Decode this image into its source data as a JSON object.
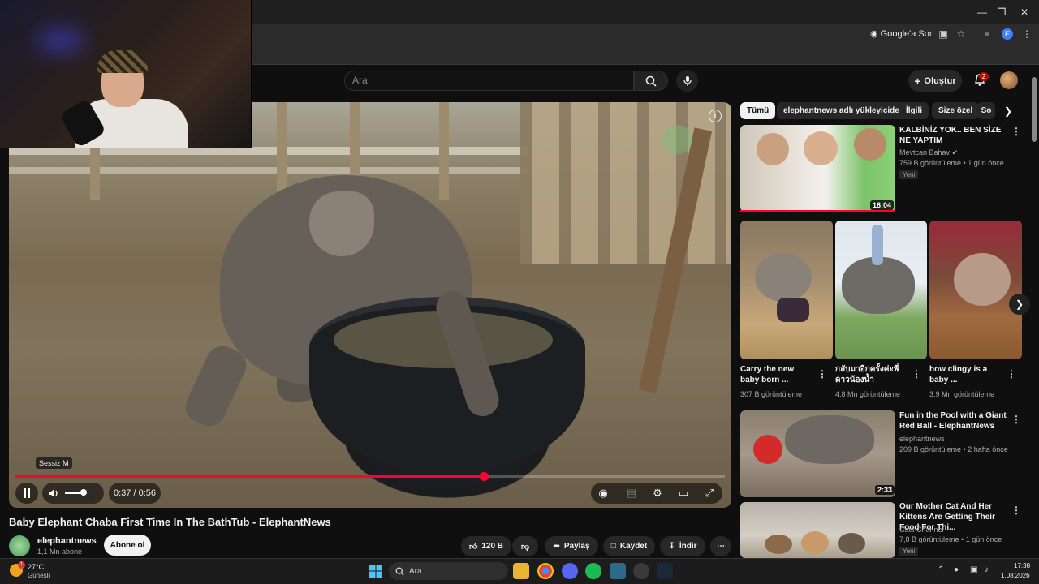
{
  "browser": {
    "google_ask_label": "Google'a Sor",
    "profile_letter": "E"
  },
  "header": {
    "search_placeholder": "Ara",
    "create_label": "Oluştur",
    "notification_count": "2"
  },
  "player": {
    "mute_tooltip": "Sessiz M",
    "time": "0:37 / 0:56",
    "progress_fraction": 0.6607,
    "volume_fraction": 0.6
  },
  "video": {
    "title": "Baby Elephant Chaba First Time In The BathTub - ElephantNews",
    "channel_name": "elephantnews",
    "channel_subs": "1,1 Mn abone",
    "subscribe_label": "Abone ol",
    "likes": "120 B",
    "share_label": "Paylaş",
    "save_label": "Kaydet",
    "download_label": "İndir"
  },
  "sidebar": {
    "chips": [
      "Tümü",
      "elephantnews adlı yükleyiciden",
      "İlgili",
      "Size özel",
      "So"
    ],
    "videos": [
      {
        "title": "KALBİNİZ YOK.. BEN SİZE NE YAPTIM",
        "channel": "Mevtcan Bahav",
        "meta": "759 B görüntüleme • 1 gün önce",
        "badge": "Yeni",
        "duration": "18:04"
      },
      {
        "title": "Fun in the Pool with a Giant Red Ball - ElephantNews",
        "channel": "elephantnews",
        "meta": "209 B görüntüleme • 2 hafta önce",
        "duration": "2:33"
      },
      {
        "title": "Our Mother Cat And Her Kittens Are Getting Their Food For Thi...",
        "channel": "Cats Channel",
        "meta": "7,8 B görüntüleme • 1 gün önce",
        "badge": "Yeni"
      }
    ],
    "shorts": [
      {
        "title": "Carry the new baby born ...",
        "views": "307 B görüntüleme"
      },
      {
        "title": "กลับมาอีกครั้งค่ะพี่ดาวน้องน้ำ",
        "views": "4,8 Mn görüntüleme"
      },
      {
        "title": "how clingy is a baby ...",
        "views": "3,9 Mn görüntüleme"
      }
    ]
  },
  "taskbar": {
    "weather_temp": "27°C",
    "weather_cond": "Güneşli",
    "weather_badge": "1",
    "search_label": "Ara",
    "time": "17:38",
    "date": "1.08.2026"
  }
}
